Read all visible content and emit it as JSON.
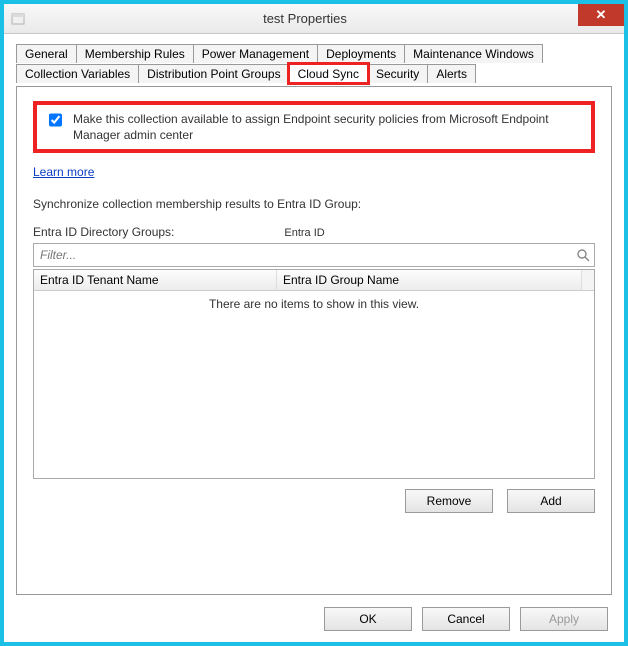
{
  "window": {
    "title": "test Properties"
  },
  "tabs_row1": [
    "General",
    "Membership Rules",
    "Power Management",
    "Deployments",
    "Maintenance Windows"
  ],
  "tabs_row2": [
    "Collection Variables",
    "Distribution Point Groups",
    "Cloud Sync",
    "Security",
    "Alerts"
  ],
  "active_tab": "Cloud Sync",
  "cloud_sync": {
    "checkbox_label": "Make this collection available to assign Endpoint security policies from Microsoft Endpoint Manager admin center",
    "checkbox_checked": true,
    "learn_more": "Learn more",
    "sync_text": "Synchronize collection membership results to  Entra ID Group:",
    "group_label": "Entra ID Directory Groups:",
    "group_label_small": "Entra ID",
    "filter_placeholder": "Filter...",
    "columns": {
      "tenant": "Entra ID  Tenant  Name",
      "group": "Entra ID  Group  Name"
    },
    "empty_text": "There are no items to show in this view.",
    "remove_btn": "Remove",
    "add_btn": "Add"
  },
  "dialog_buttons": {
    "ok": "OK",
    "cancel": "Cancel",
    "apply": "Apply"
  }
}
